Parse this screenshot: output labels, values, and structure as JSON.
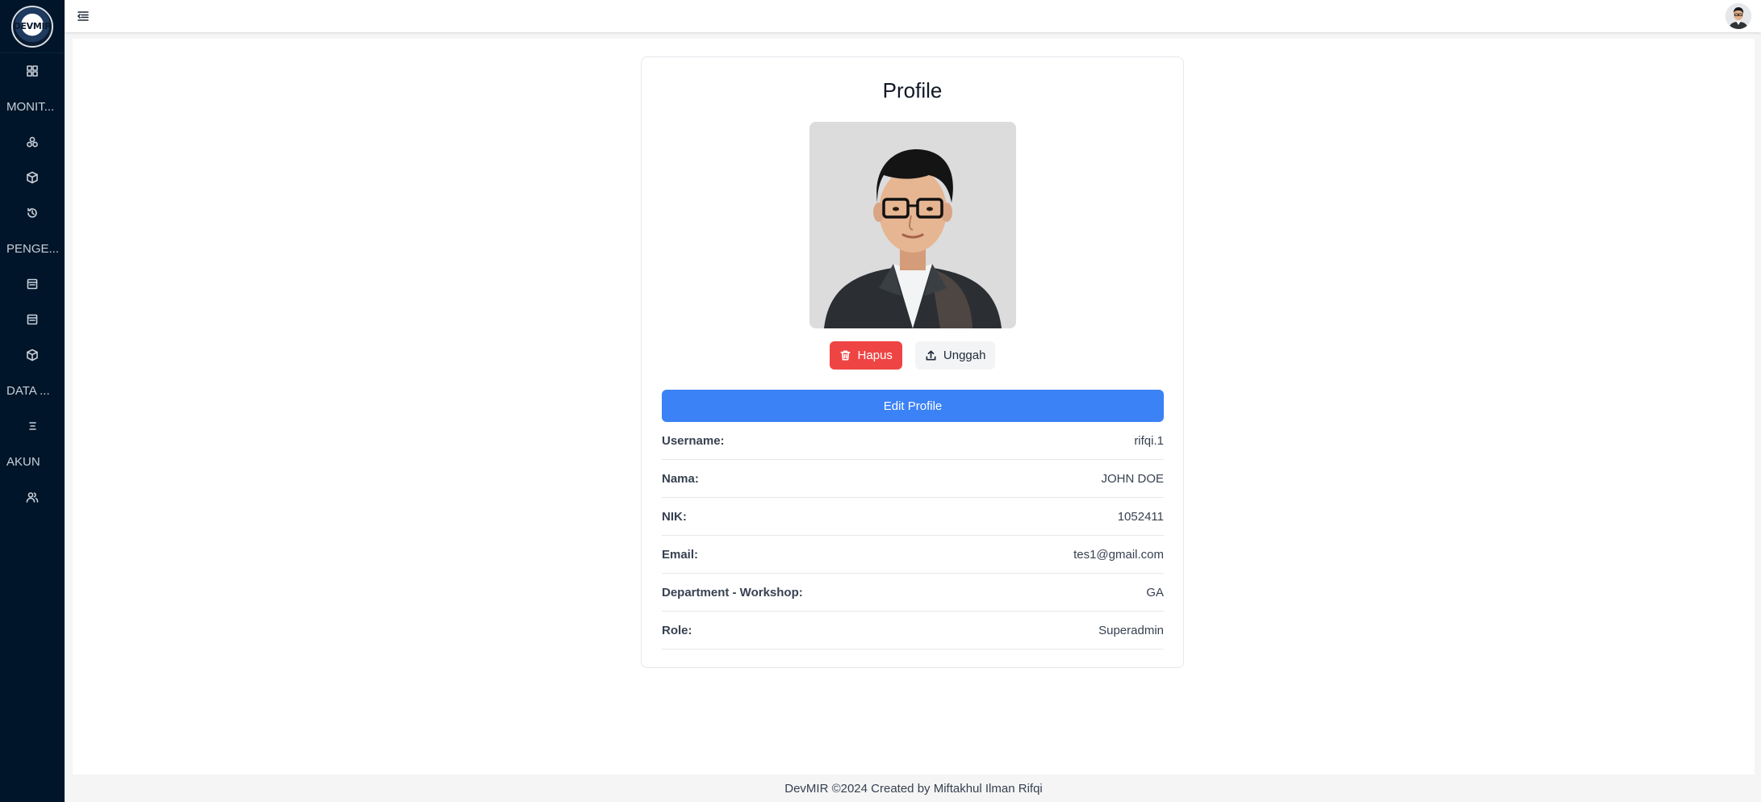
{
  "sidebar": {
    "logo_text": "DEVMIR",
    "groups": {
      "monitoring": "MONIT...",
      "pengelolaan": "PENGE...",
      "data": "DATA ...",
      "akun": "AKUN"
    },
    "icons": [
      "dashboard-icon",
      "cluster-icon",
      "cube-icon",
      "history-icon",
      "calendar-icon",
      "calendar-icon",
      "cube-icon",
      "list-icon",
      "users-icon"
    ]
  },
  "profile": {
    "title": "Profile",
    "delete_label": "Hapus",
    "upload_label": "Unggah",
    "edit_label": "Edit Profile",
    "fields": [
      {
        "label": "Username:",
        "value": "rifqi.1"
      },
      {
        "label": "Nama:",
        "value": "JOHN DOE"
      },
      {
        "label": "NIK:",
        "value": "1052411"
      },
      {
        "label": "Email:",
        "value": "tes1@gmail.com"
      },
      {
        "label": "Department - Workshop:",
        "value": "GA"
      },
      {
        "label": "Role:",
        "value": "Superadmin"
      }
    ]
  },
  "footer": {
    "text": "DevMIR ©2024 Created by Miftakhul Ilman Rifqi"
  },
  "colors": {
    "sidebar_bg": "#001529",
    "primary": "#3b82f6",
    "danger": "#ef4444"
  }
}
